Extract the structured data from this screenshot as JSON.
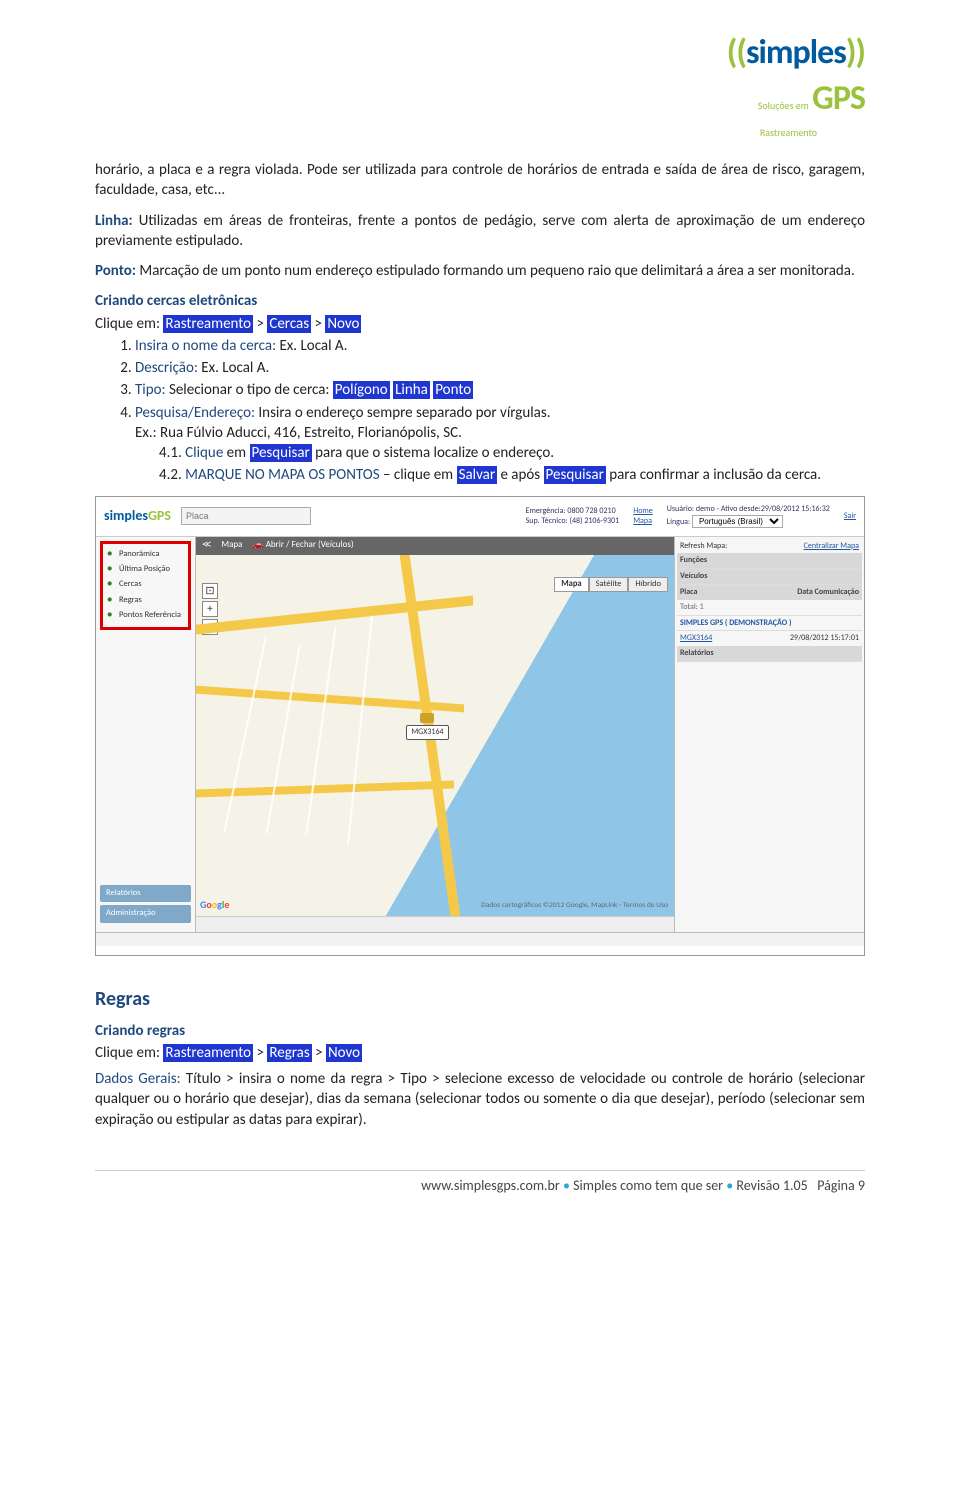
{
  "logo": {
    "brand1": "simples",
    "brand2": "GPS",
    "sub1": "Soluções em",
    "sub2": "Rastreamento"
  },
  "para1": "horário, a placa e a regra violada. Pode ser utilizada para controle de horários de entrada e saída de área de risco, garagem, faculdade, casa, etc...",
  "linha_label": "Linha:",
  "linha_text": " Utilizadas em áreas de fronteiras, frente a pontos de pedágio, serve com alerta de aproximação de um endereço previamente estipulado.",
  "ponto_label": "Ponto:",
  "ponto_text": " Marcação de um ponto num endereço estipulado formando um pequeno raio que delimitará a área a ser monitorada.",
  "sec_cercas": "Criando cercas eletrônicas",
  "clique_em": "Clique em: ",
  "rastreamento": "Rastreamento",
  "gt": " > ",
  "cercas": "Cercas",
  "novo": "Novo",
  "li1a": "Insira o nome da cerca:",
  "li1b": " Ex. Local A.",
  "li2a": "Descrição:",
  "li2b": " Ex. Local A.",
  "li3a": "Tipo:",
  "li3b": " Selecionar o tipo de cerca: ",
  "poligono": "Polígono",
  "linha_btn": "Linha",
  "ponto_btn": "Ponto",
  "li4a": "Pesquisa/Endereço:",
  "li4b": " Insira o endereço sempre separado por vírgulas.",
  "li4ex": "Ex.: Rua Fúlvio Aducci, 416, Estreito, Florianópolis, SC.",
  "li41num": "4.1. ",
  "li41a": "Clique",
  "li41b": " em ",
  "pesquisar": "Pesquisar",
  "li41c": " para que o sistema localize o endereço.",
  "li42num": "4.2. ",
  "li42a": "MARQUE NO MAPA OS PONTOS",
  "li42b": " – clique em ",
  "salvar": "Salvar",
  "li42c": " e após ",
  "li42d": " para confirmar a inclusão da cerca.",
  "shot": {
    "placa_ph": "Placa",
    "emerg": "Emergência: 0800 728 0210",
    "sup": "Sup. Técnico: (48) 2106-9301",
    "home": "Home",
    "mapa_link": "Mapa",
    "usuario": "Usuário: demo - Ativo desde:29/08/2012 15:16:32",
    "lingua": "Língua:",
    "idioma": "Português (Brasil)",
    "sair": "Sair",
    "side": [
      "Panorâmica",
      "Última Posição",
      "Cercas",
      "Regras",
      "Pontos Referência"
    ],
    "relatorios": "Relatórios",
    "admin": "Administração",
    "mapbar_mapa": "Mapa",
    "mapbar_abrir": "Abrir / Fechar (Veículos)",
    "maptype": [
      "Mapa",
      "Satélite",
      "Híbrido"
    ],
    "refresh": "Refresh Mapa:",
    "centralizar": "Centralizar Mapa",
    "funcoes": "Funções",
    "veiculos": "Veículos",
    "col_placa": "Placa",
    "col_data": "Data Comunicação",
    "total": "Total: 1",
    "demo": "SIMPLES GPS ( DEMONSTRAÇÃO )",
    "placa_val": "MGX3164",
    "data_val": "29/08/2012 15:17:01",
    "relatorios2": "Relatórios",
    "marker": "MGX3164",
    "attr": "Dados cartográficos ©2012 Google, MapLink - Termos de Uso"
  },
  "regras_h": "Regras",
  "sec_regras": "Criando regras",
  "regras_link": "Regras",
  "dados_label": "Dados Gerais:",
  "dados_text": " Título > insira o nome da regra > Tipo > selecione excesso de velocidade ou controle de horário (selecionar qualquer ou o horário que desejar), dias da semana (selecionar todos ou somente o dia que desejar), período (selecionar sem expiração ou estipular as datas para expirar).",
  "footer": {
    "url": "www.simplesgps.com.br",
    "mid": "Simples como tem que ser",
    "rev": "Revisão 1.05",
    "page": "Página 9"
  }
}
